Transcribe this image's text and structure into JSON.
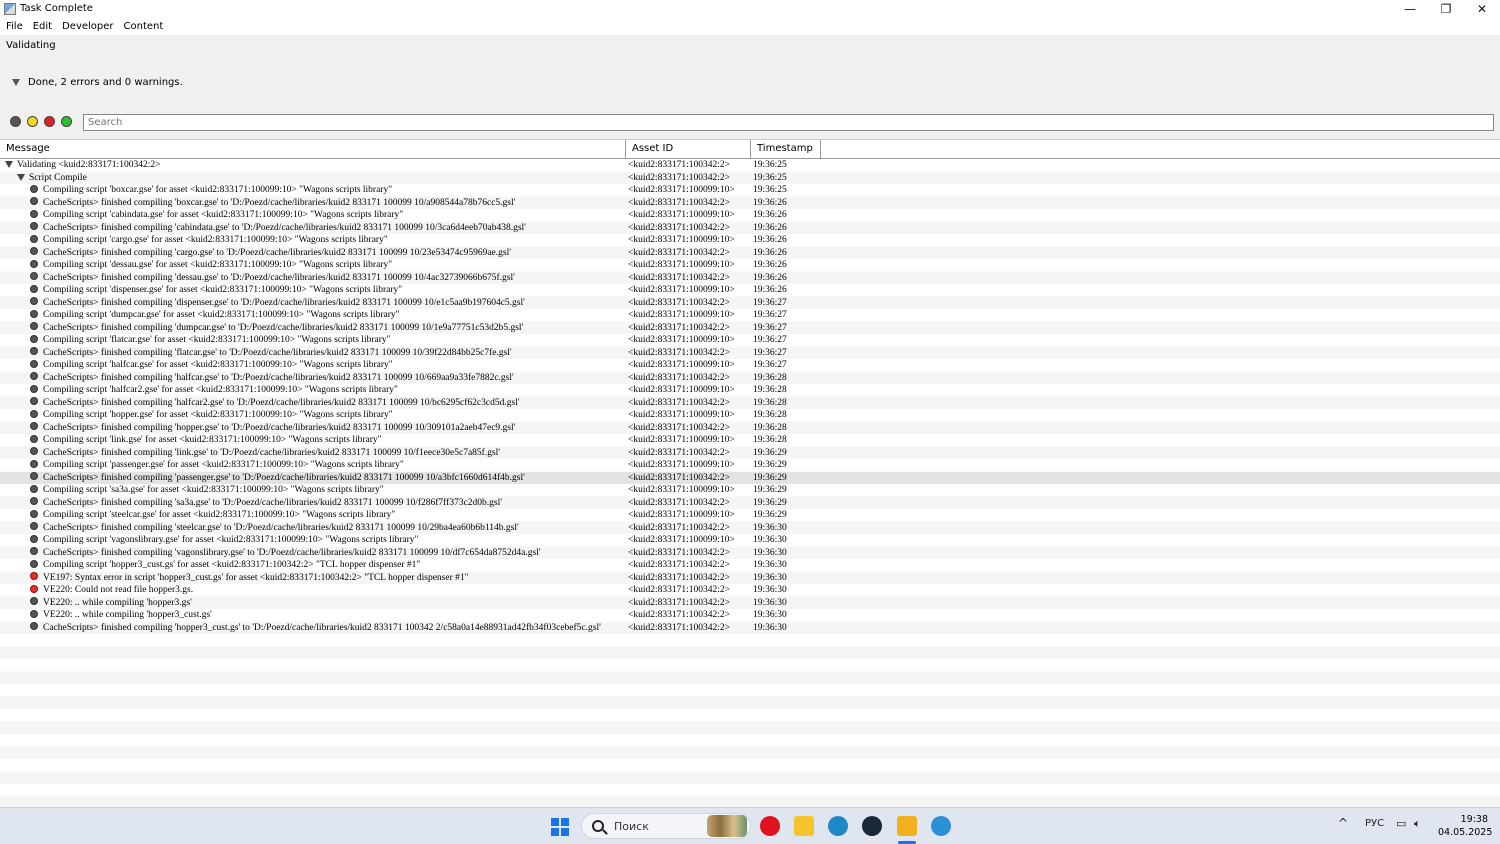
{
  "window": {
    "title": "Task Complete",
    "controls": [
      "—",
      "❐",
      "✕"
    ]
  },
  "menu": [
    "File",
    "Edit",
    "Developer",
    "Content"
  ],
  "status_label": "Validating",
  "summary": "Done, 2 errors and 0 warnings.",
  "filters": {
    "colors": [
      "#555555",
      "#f2d820",
      "#e02020",
      "#2fbf2f"
    ],
    "names": [
      "all-filter",
      "warning-filter",
      "error-filter",
      "success-filter"
    ]
  },
  "search": {
    "placeholder": "Search",
    "value": ""
  },
  "columns": [
    "Message",
    "Asset ID",
    "Timestamp"
  ],
  "rows": [
    {
      "level": 0,
      "icon": "expand",
      "msg": "Validating <kuid2:833171:100342:2>",
      "asset": "<kuid2:833171:100342:2>",
      "time": "19:36:25"
    },
    {
      "level": 1,
      "icon": "expand",
      "msg": "Script Compile",
      "asset": "<kuid2:833171:100342:2>",
      "time": "19:36:25"
    },
    {
      "level": 2,
      "icon": "info",
      "msg": "Compiling script 'boxcar.gse' for asset <kuid2:833171:100099:10> \"Wagons scripts library\"",
      "asset": "<kuid2:833171:100099:10>",
      "time": "19:36:25"
    },
    {
      "level": 2,
      "icon": "info",
      "msg": "CacheScripts> finished compiling 'boxcar.gse' to 'D:/Poezd/cache/libraries/kuid2 833171 100099 10/a908544a78b76cc5.gsl'",
      "asset": "<kuid2:833171:100342:2>",
      "time": "19:36:26"
    },
    {
      "level": 2,
      "icon": "info",
      "msg": "Compiling script 'cabindata.gse' for asset <kuid2:833171:100099:10> \"Wagons scripts library\"",
      "asset": "<kuid2:833171:100099:10>",
      "time": "19:36:26"
    },
    {
      "level": 2,
      "icon": "info",
      "msg": "CacheScripts> finished compiling 'cabindata.gse' to 'D:/Poezd/cache/libraries/kuid2 833171 100099 10/3ca6d4eeb70ab438.gsl'",
      "asset": "<kuid2:833171:100342:2>",
      "time": "19:36:26"
    },
    {
      "level": 2,
      "icon": "info",
      "msg": "Compiling script 'cargo.gse' for asset <kuid2:833171:100099:10> \"Wagons scripts library\"",
      "asset": "<kuid2:833171:100099:10>",
      "time": "19:36:26"
    },
    {
      "level": 2,
      "icon": "info",
      "msg": "CacheScripts> finished compiling 'cargo.gse' to 'D:/Poezd/cache/libraries/kuid2 833171 100099 10/23e53474c95969ae.gsl'",
      "asset": "<kuid2:833171:100342:2>",
      "time": "19:36:26"
    },
    {
      "level": 2,
      "icon": "info",
      "msg": "Compiling script 'dessau.gse' for asset <kuid2:833171:100099:10> \"Wagons scripts library\"",
      "asset": "<kuid2:833171:100099:10>",
      "time": "19:36:26"
    },
    {
      "level": 2,
      "icon": "info",
      "msg": "CacheScripts> finished compiling 'dessau.gse' to 'D:/Poezd/cache/libraries/kuid2 833171 100099 10/4ac32739066b675f.gsl'",
      "asset": "<kuid2:833171:100342:2>",
      "time": "19:36:26"
    },
    {
      "level": 2,
      "icon": "info",
      "msg": "Compiling script 'dispenser.gse' for asset <kuid2:833171:100099:10> \"Wagons scripts library\"",
      "asset": "<kuid2:833171:100099:10>",
      "time": "19:36:26"
    },
    {
      "level": 2,
      "icon": "info",
      "msg": "CacheScripts> finished compiling 'dispenser.gse' to 'D:/Poezd/cache/libraries/kuid2 833171 100099 10/e1c5aa9b197604c5.gsl'",
      "asset": "<kuid2:833171:100342:2>",
      "time": "19:36:27"
    },
    {
      "level": 2,
      "icon": "info",
      "msg": "Compiling script 'dumpcar.gse' for asset <kuid2:833171:100099:10> \"Wagons scripts library\"",
      "asset": "<kuid2:833171:100099:10>",
      "time": "19:36:27"
    },
    {
      "level": 2,
      "icon": "info",
      "msg": "CacheScripts> finished compiling 'dumpcar.gse' to 'D:/Poezd/cache/libraries/kuid2 833171 100099 10/1e9a77751c53d2b5.gsl'",
      "asset": "<kuid2:833171:100342:2>",
      "time": "19:36:27"
    },
    {
      "level": 2,
      "icon": "info",
      "msg": "Compiling script 'flatcar.gse' for asset <kuid2:833171:100099:10> \"Wagons scripts library\"",
      "asset": "<kuid2:833171:100099:10>",
      "time": "19:36:27"
    },
    {
      "level": 2,
      "icon": "info",
      "msg": "CacheScripts> finished compiling 'flatcar.gse' to 'D:/Poezd/cache/libraries/kuid2 833171 100099 10/39f22d84bb25c7fe.gsl'",
      "asset": "<kuid2:833171:100342:2>",
      "time": "19:36:27"
    },
    {
      "level": 2,
      "icon": "info",
      "msg": "Compiling script 'halfcar.gse' for asset <kuid2:833171:100099:10> \"Wagons scripts library\"",
      "asset": "<kuid2:833171:100099:10>",
      "time": "19:36:27"
    },
    {
      "level": 2,
      "icon": "info",
      "msg": "CacheScripts> finished compiling 'halfcar.gse' to 'D:/Poezd/cache/libraries/kuid2 833171 100099 10/669aa9a33fe7882c.gsl'",
      "asset": "<kuid2:833171:100342:2>",
      "time": "19:36:28"
    },
    {
      "level": 2,
      "icon": "info",
      "msg": "Compiling script 'halfcar2.gse' for asset <kuid2:833171:100099:10> \"Wagons scripts library\"",
      "asset": "<kuid2:833171:100099:10>",
      "time": "19:36:28"
    },
    {
      "level": 2,
      "icon": "info",
      "msg": "CacheScripts> finished compiling 'halfcar2.gse' to 'D:/Poezd/cache/libraries/kuid2 833171 100099 10/bc6295cf62c3cd5d.gsl'",
      "asset": "<kuid2:833171:100342:2>",
      "time": "19:36:28"
    },
    {
      "level": 2,
      "icon": "info",
      "msg": "Compiling script 'hopper.gse' for asset <kuid2:833171:100099:10> \"Wagons scripts library\"",
      "asset": "<kuid2:833171:100099:10>",
      "time": "19:36:28"
    },
    {
      "level": 2,
      "icon": "info",
      "msg": "CacheScripts> finished compiling 'hopper.gse' to 'D:/Poezd/cache/libraries/kuid2 833171 100099 10/309101a2aeb47ec9.gsl'",
      "asset": "<kuid2:833171:100342:2>",
      "time": "19:36:28"
    },
    {
      "level": 2,
      "icon": "info",
      "msg": "Compiling script 'link.gse' for asset <kuid2:833171:100099:10> \"Wagons scripts library\"",
      "asset": "<kuid2:833171:100099:10>",
      "time": "19:36:28"
    },
    {
      "level": 2,
      "icon": "info",
      "msg": "CacheScripts> finished compiling 'link.gse' to 'D:/Poezd/cache/libraries/kuid2 833171 100099 10/f1eece30e5c7a85f.gsl'",
      "asset": "<kuid2:833171:100342:2>",
      "time": "19:36:29"
    },
    {
      "level": 2,
      "icon": "info",
      "msg": "Compiling script 'passenger.gse' for asset <kuid2:833171:100099:10> \"Wagons scripts library\"",
      "asset": "<kuid2:833171:100099:10>",
      "time": "19:36:29"
    },
    {
      "level": 2,
      "icon": "info",
      "msg": "CacheScripts> finished compiling 'passenger.gse' to 'D:/Poezd/cache/libraries/kuid2 833171 100099 10/a3bfc1660d614f4b.gsl'",
      "asset": "<kuid2:833171:100342:2>",
      "time": "19:36:29",
      "selected": true
    },
    {
      "level": 2,
      "icon": "info",
      "msg": "Compiling script 'sa3a.gse' for asset <kuid2:833171:100099:10> \"Wagons scripts library\"",
      "asset": "<kuid2:833171:100099:10>",
      "time": "19:36:29"
    },
    {
      "level": 2,
      "icon": "info",
      "msg": "CacheScripts> finished compiling 'sa3a.gse' to 'D:/Poezd/cache/libraries/kuid2 833171 100099 10/f286f7ff373c2d0b.gsl'",
      "asset": "<kuid2:833171:100342:2>",
      "time": "19:36:29"
    },
    {
      "level": 2,
      "icon": "info",
      "msg": "Compiling script 'steelcar.gse' for asset <kuid2:833171:100099:10> \"Wagons scripts library\"",
      "asset": "<kuid2:833171:100099:10>",
      "time": "19:36:29"
    },
    {
      "level": 2,
      "icon": "info",
      "msg": "CacheScripts> finished compiling 'steelcar.gse' to 'D:/Poezd/cache/libraries/kuid2 833171 100099 10/29ba4ea60b6b114b.gsl'",
      "asset": "<kuid2:833171:100342:2>",
      "time": "19:36:30"
    },
    {
      "level": 2,
      "icon": "info",
      "msg": "Compiling script 'vagonslibrary.gse' for asset <kuid2:833171:100099:10> \"Wagons scripts library\"",
      "asset": "<kuid2:833171:100099:10>",
      "time": "19:36:30"
    },
    {
      "level": 2,
      "icon": "info",
      "msg": "CacheScripts> finished compiling 'vagonslibrary.gse' to 'D:/Poezd/cache/libraries/kuid2 833171 100099 10/df7c654da8752d4a.gsl'",
      "asset": "<kuid2:833171:100342:2>",
      "time": "19:36:30"
    },
    {
      "level": 2,
      "icon": "info",
      "msg": "Compiling script 'hopper3_cust.gs' for asset <kuid2:833171:100342:2> \"TCL hopper dispenser #1\"",
      "asset": "<kuid2:833171:100342:2>",
      "time": "19:36:30"
    },
    {
      "level": 2,
      "icon": "error",
      "msg": "VE197: Syntax error in script 'hopper3_cust.gs' for asset <kuid2:833171:100342:2> \"TCL hopper dispenser #1\"",
      "asset": "<kuid2:833171:100342:2>",
      "time": "19:36:30"
    },
    {
      "level": 2,
      "icon": "error",
      "msg": "VE220: Could not read file hopper3.gs.",
      "asset": "<kuid2:833171:100342:2>",
      "time": "19:36:30"
    },
    {
      "level": 2,
      "icon": "info",
      "msg": "VE220: .. while compiling 'hopper3.gs'",
      "asset": "<kuid2:833171:100342:2>",
      "time": "19:36:30"
    },
    {
      "level": 2,
      "icon": "info",
      "msg": "VE220: .. while compiling 'hopper3_cust.gs'",
      "asset": "<kuid2:833171:100342:2>",
      "time": "19:36:30"
    },
    {
      "level": 2,
      "icon": "info",
      "msg": "CacheScripts> finished compiling 'hopper3_cust.gs' to 'D:/Poezd/cache/libraries/kuid2 833171 100342 2/c58a0a14e88931ad42fb34f03cebef5c.gsl'",
      "asset": "<kuid2:833171:100342:2>",
      "time": "19:36:30"
    }
  ],
  "taskbar": {
    "search_placeholder": "Поиск",
    "apps": [
      {
        "name": "opera-icon",
        "color": "#e0121b"
      },
      {
        "name": "file-explorer-icon",
        "color": "#f5c32c"
      },
      {
        "name": "edge-icon",
        "color": "#1e88c9"
      },
      {
        "name": "steam-icon",
        "color": "#1b2838"
      },
      {
        "name": "app-folder-icon",
        "color": "#f2b01e"
      },
      {
        "name": "globe-app-icon",
        "color": "#2d8fd5"
      }
    ],
    "language": "РУС",
    "time": "19:38",
    "date": "04.05.2025"
  }
}
